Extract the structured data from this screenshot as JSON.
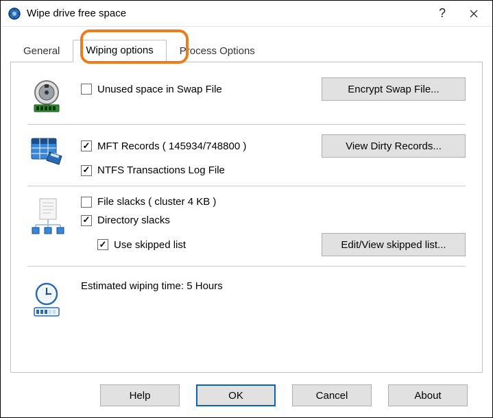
{
  "window": {
    "title": "Wipe drive free space",
    "help_tooltip": "?",
    "close_tooltip": "×"
  },
  "tabs": {
    "general": "General",
    "wiping": "Wiping options",
    "process": "Process Options"
  },
  "swap": {
    "checkbox_label": "Unused space in Swap File",
    "button_label": "Encrypt Swap File..."
  },
  "mft": {
    "records_label": "MFT Records ( 145934/748800 )",
    "ntfs_log_label": "NTFS Transactions Log File",
    "button_label": "View Dirty Records..."
  },
  "slacks": {
    "file_slacks_label": "File slacks ( cluster 4 KB )",
    "dir_slacks_label": "Directory slacks",
    "use_skipped_label": "Use skipped list",
    "button_label": "Edit/View skipped list..."
  },
  "estimate": {
    "label": "Estimated wiping time:  5 Hours"
  },
  "buttons": {
    "help": "Help",
    "ok": "OK",
    "cancel": "Cancel",
    "about": "About"
  }
}
